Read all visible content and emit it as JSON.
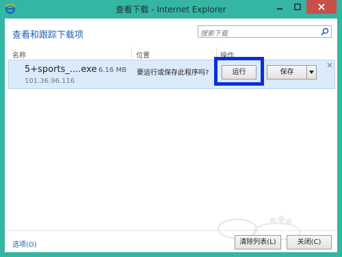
{
  "window": {
    "title": "查看下载 - Internet Explorer",
    "accent": "#35b5a4",
    "close_color": "#c7504a"
  },
  "header": {
    "title": "查看和跟踪下载项"
  },
  "search": {
    "placeholder": "搜索下载",
    "icon": "search-icon"
  },
  "columns": {
    "name": "名称",
    "location": "位置",
    "actions": "操作"
  },
  "downloads": [
    {
      "name": "5+sports_....exe",
      "size": "6.16 MB",
      "source": "101.36.96.116",
      "message": "要运行或保存此程序吗?",
      "run_label": "运行",
      "save_label": "保存"
    }
  ],
  "highlight_color": "#0b2fd8",
  "footer": {
    "options_label": "选项(O)",
    "clear_list_label": "清除列表(L)",
    "close_label": "关闭(C)"
  }
}
